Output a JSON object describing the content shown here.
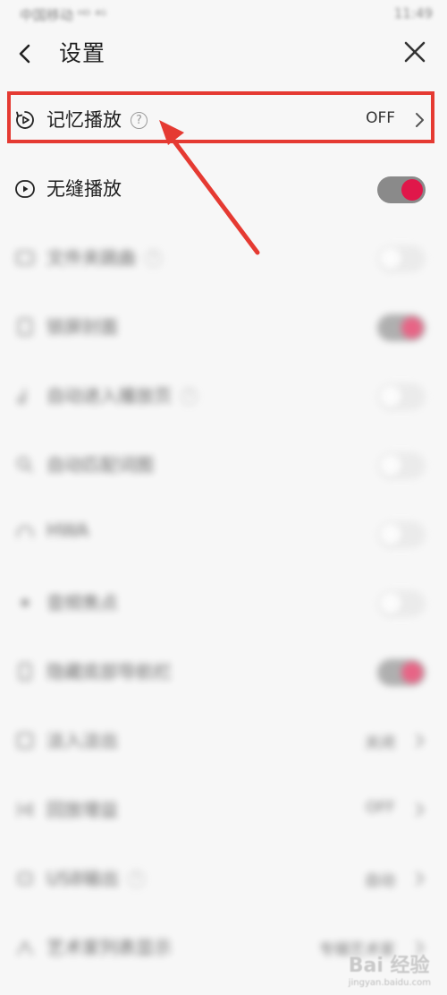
{
  "status_bar": {
    "carrier": "中国移动 ᴴᴰ  ⁴ᴳ",
    "time": "11:49"
  },
  "header": {
    "title": "设置"
  },
  "rows": [
    {
      "label": "记忆播放",
      "value": "OFF"
    },
    {
      "label": "无缝播放"
    },
    {
      "label": "文件夹跳曲"
    },
    {
      "label": "锁屏封面"
    },
    {
      "label": "自动进入播放页"
    },
    {
      "label": "自动匹配词图"
    },
    {
      "label": "HWA"
    },
    {
      "label": "音频焦点"
    },
    {
      "label": "隐藏底部导航栏"
    },
    {
      "label": "淡入淡出",
      "value": "关闭"
    },
    {
      "label": "回放增益",
      "value": "OFF"
    },
    {
      "label": "USB输出",
      "value": "自动"
    },
    {
      "label": "艺术家列表显示",
      "value": "专辑艺术家"
    }
  ],
  "colors": {
    "accent": "#e0174a",
    "annotation": "#e53a32"
  },
  "watermark": {
    "text": "Bai 经验",
    "sub": "jingyan.baidu.com"
  }
}
